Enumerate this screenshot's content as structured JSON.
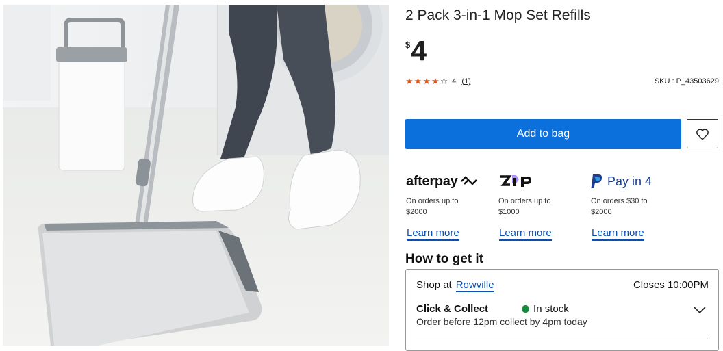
{
  "product": {
    "title": "2 Pack 3-in-1 Mop Set Refills",
    "currency_symbol": "$",
    "price": "4",
    "rating": {
      "value": 4,
      "max": 5,
      "label": "4",
      "count": "(1)"
    },
    "sku": "SKU : P_43503629",
    "image_icon": "mop-product-photo"
  },
  "actions": {
    "add_to_bag": "Add to bag",
    "wishlist_icon": "heart-icon"
  },
  "payments": [
    {
      "name": "afterpay",
      "logo_text": "afterpay",
      "line1": "On orders up to",
      "line2": "$2000",
      "learn": "Learn more"
    },
    {
      "name": "zip",
      "logo_text": "zip",
      "line1": "On orders up to",
      "line2": "$1000",
      "learn": "Learn more"
    },
    {
      "name": "paypal",
      "logo_text": "Pay in 4",
      "line1": "On orders $30 to",
      "line2": "$2000",
      "learn": "Learn more"
    }
  ],
  "fulfilment": {
    "heading": "How to get it",
    "shop_at": "Shop at",
    "store": "Rowville",
    "closes": "Closes 10:00PM",
    "method": "Click & Collect",
    "stock": "In stock",
    "note": "Order before 12pm collect by 4pm today"
  },
  "colors": {
    "accent": "#0b6fdc",
    "link": "#0b4fb3",
    "star": "#e0561b",
    "in_stock": "#1b8a3a",
    "paypal": "#1c3f94"
  }
}
